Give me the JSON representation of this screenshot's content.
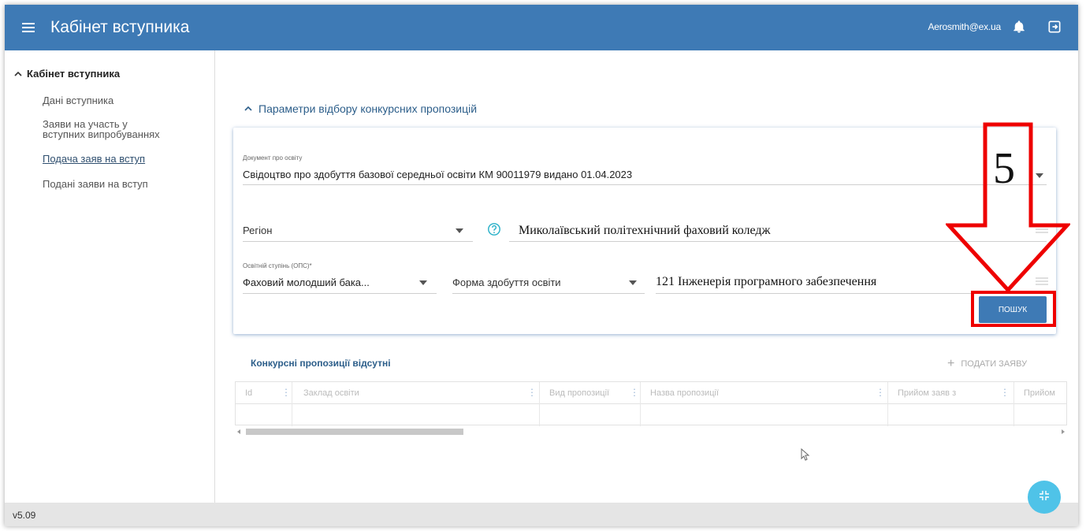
{
  "header": {
    "title": "Кабінет вступника",
    "user_email": "Aerosmith@ex.ua"
  },
  "sidebar": {
    "section": "Кабінет вступника",
    "items": [
      {
        "label": "Дані вступника"
      },
      {
        "label": "Заяви на участь у"
      },
      {
        "label": "вступних випробуваннях"
      },
      {
        "label": "Подача заяв на вступ"
      },
      {
        "label": "Подані заяви на вступ"
      }
    ]
  },
  "version": "v5.09",
  "filters": {
    "section_title": "Параметри відбору конкурсних пропозицій",
    "document_label": "Документ про освіту",
    "document_value": "Свідоцтво про здобуття базової середньої освіти КМ 90011979 видано 01.04.2023",
    "region_placeholder": "Регіон",
    "institution_value": "Миколаївський політехнічний фаховий коледж",
    "degree_label": "Освітній ступінь (ОПС)*",
    "degree_value": "Фаховий молодший бака...",
    "form_placeholder": "Форма здобуття освіти",
    "specialty_value": "121 Інженерія програмного забезпечення",
    "search_label": "ПОШУК"
  },
  "annotation": {
    "step_number": "5",
    "highlight_color": "#ee0000"
  },
  "results": {
    "title": "Конкурсні пропозиції відсутні",
    "add_label": "ПОДАТИ ЗАЯВУ",
    "columns": [
      "Id",
      "Заклад освіти",
      "Вид пропозиції",
      "Назва пропозиції",
      "Прийом заяв з",
      "Прийом"
    ]
  },
  "colors": {
    "header": "#3e7ab5",
    "accent": "#2c5e8a",
    "fab": "#4fc3e8"
  }
}
